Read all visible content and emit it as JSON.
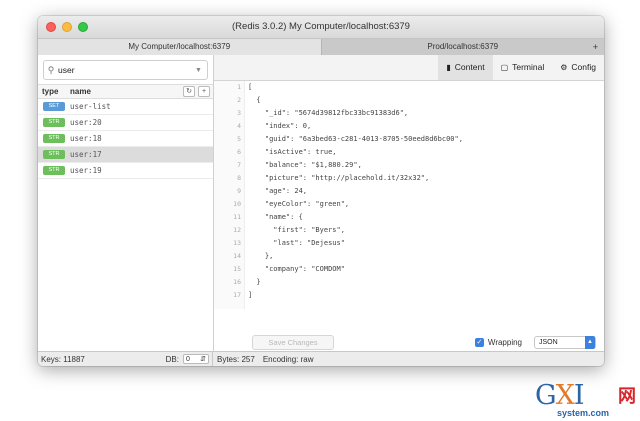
{
  "window": {
    "title": "(Redis 3.0.2) My Computer/localhost:6379",
    "tabs": [
      {
        "label": "My Computer/localhost:6379",
        "active": true
      },
      {
        "label": "Prod/localhost:6379",
        "active": false
      }
    ],
    "tab_add": "+"
  },
  "sidebar": {
    "search": {
      "value": "user",
      "placeholder": ""
    },
    "header": {
      "type": "type",
      "name": "name",
      "refresh": "↻",
      "add": "+"
    },
    "keys": [
      {
        "type": "SET",
        "name": "user-list",
        "color": "#5b9bd5"
      },
      {
        "type": "STR",
        "name": "user:20",
        "color": "#6cbf5a"
      },
      {
        "type": "STR",
        "name": "user:18",
        "color": "#6cbf5a"
      },
      {
        "type": "STR",
        "name": "user:17",
        "color": "#6cbf5a",
        "selected": true
      },
      {
        "type": "STR",
        "name": "user:19",
        "color": "#6cbf5a"
      }
    ]
  },
  "toolbar": {
    "content": "Content",
    "terminal": "Terminal",
    "config": "Config"
  },
  "editor": {
    "lines": [
      "[",
      "  {",
      "    \"_id\": \"5674d39812fbc33bc91383d6\",",
      "    \"index\": 0,",
      "    \"guid\": \"6a3bed63-c281-4013-8705-50eed8d6bc00\",",
      "    \"isActive\": true,",
      "    \"balance\": \"$1,880.29\",",
      "    \"picture\": \"http://placehold.it/32x32\",",
      "    \"age\": 24,",
      "    \"eyeColor\": \"green\",",
      "    \"name\": {",
      "      \"first\": \"Byers\",",
      "      \"last\": \"Dejesus\"",
      "    },",
      "    \"company\": \"COMDOM\"",
      "  }",
      "]"
    ],
    "line_numbers": [
      "1",
      "2",
      "3",
      "4",
      "5",
      "6",
      "7",
      "8",
      "9",
      "10",
      "11",
      "12",
      "13",
      "14",
      "15",
      "16",
      "17"
    ],
    "save_label": "Save Changes",
    "wrapping_label": "Wrapping",
    "wrapping_checked": true,
    "format": "JSON"
  },
  "status": {
    "keys": "Keys: 11887",
    "db_label": "DB:",
    "db_value": "0",
    "bytes": "Bytes: 257",
    "encoding": "Encoding: raw"
  },
  "watermark": {
    "logo_g": "G",
    "logo_x": "X",
    "logo_i": "I",
    "cn": "网",
    "sub": "system.com"
  }
}
